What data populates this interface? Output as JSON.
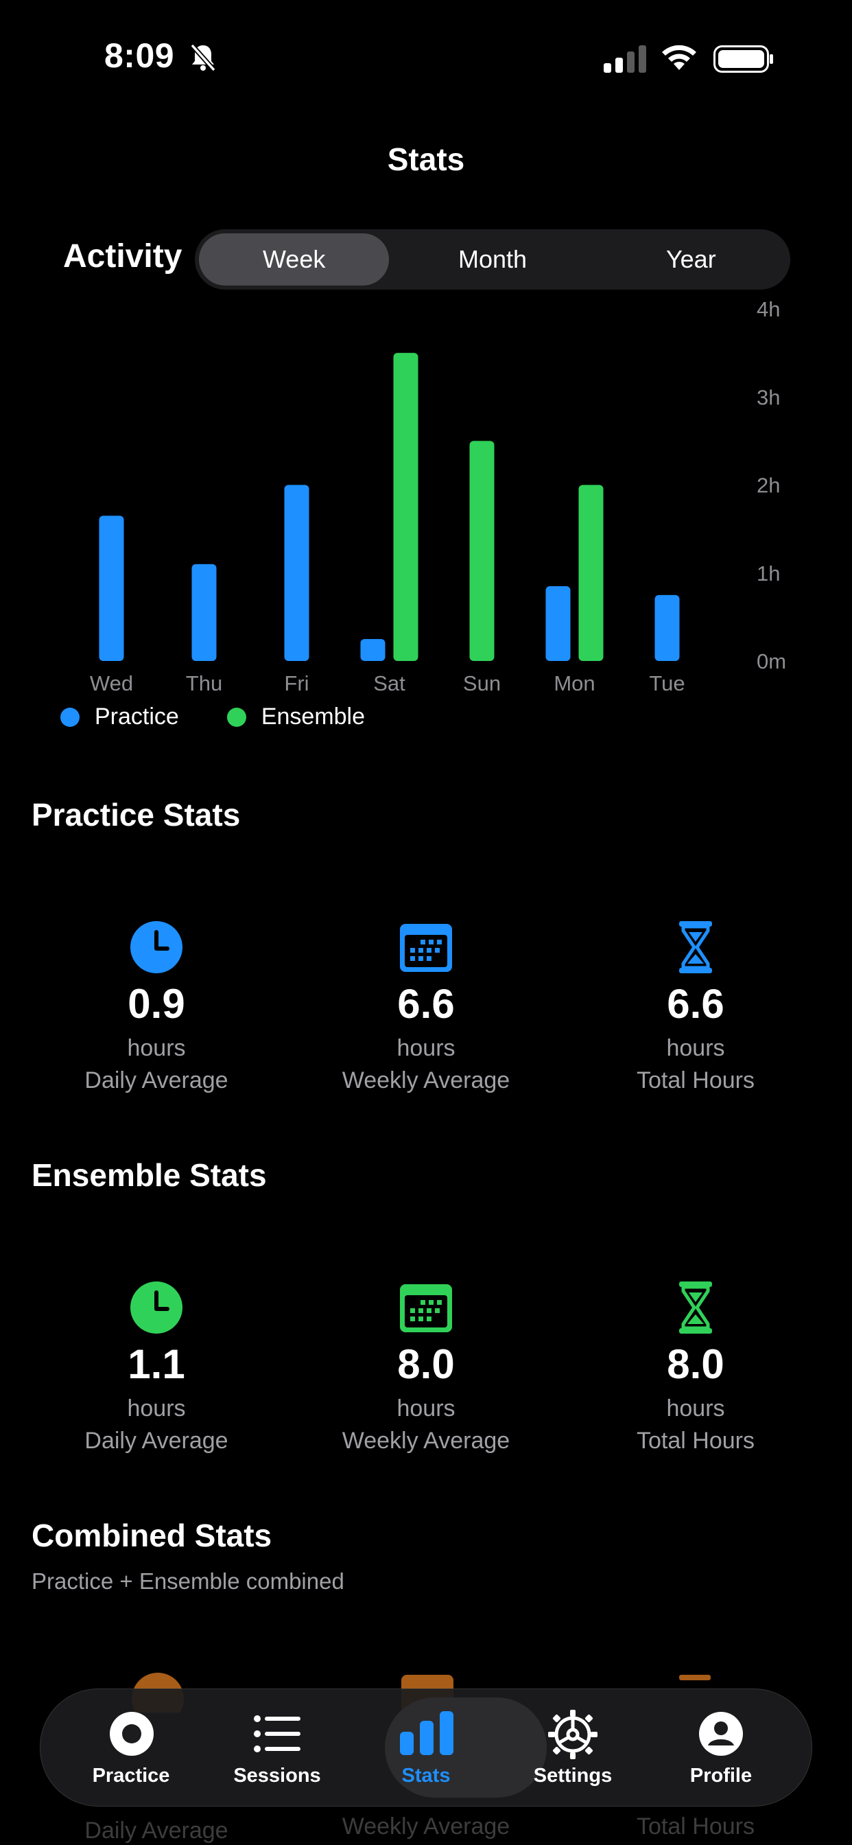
{
  "status_bar": {
    "time": "8:09"
  },
  "nav": {
    "title": "Stats"
  },
  "activity": {
    "label": "Activity",
    "segments": [
      "Week",
      "Month",
      "Year"
    ],
    "selected": "Week"
  },
  "chart_data": {
    "type": "bar",
    "categories": [
      "Wed",
      "Thu",
      "Fri",
      "Sat",
      "Sun",
      "Mon",
      "Tue"
    ],
    "series": [
      {
        "name": "Practice",
        "color": "#1e90ff",
        "values": [
          1.65,
          1.1,
          2.0,
          0.25,
          0,
          0.85,
          0.75
        ]
      },
      {
        "name": "Ensemble",
        "color": "#30d158",
        "values": [
          0,
          0,
          0,
          3.5,
          2.5,
          2.0,
          0
        ]
      }
    ],
    "y_ticks": [
      "0m",
      "1h",
      "2h",
      "3h",
      "4h"
    ],
    "ylim": [
      0,
      4
    ],
    "y_unit": "hours",
    "legend_position": "bottom-left"
  },
  "practice_stats": {
    "title": "Practice Stats",
    "color": "#1e90ff",
    "items": [
      {
        "icon": "clock-icon",
        "value": "0.9",
        "unit": "hours",
        "label": "Daily Average"
      },
      {
        "icon": "calendar-icon",
        "value": "6.6",
        "unit": "hours",
        "label": "Weekly Average"
      },
      {
        "icon": "hourglass-icon",
        "value": "6.6",
        "unit": "hours",
        "label": "Total Hours"
      }
    ]
  },
  "ensemble_stats": {
    "title": "Ensemble Stats",
    "color": "#30d158",
    "items": [
      {
        "icon": "clock-icon",
        "value": "1.1",
        "unit": "hours",
        "label": "Daily Average"
      },
      {
        "icon": "calendar-icon",
        "value": "8.0",
        "unit": "hours",
        "label": "Weekly Average"
      },
      {
        "icon": "hourglass-icon",
        "value": "8.0",
        "unit": "hours",
        "label": "Total Hours"
      }
    ]
  },
  "combined_stats": {
    "title": "Combined Stats",
    "subtitle": "Practice + Ensemble combined",
    "color": "#f08c28",
    "peek_labels": [
      "Daily Average",
      "Weekly Average",
      "Total Hours"
    ]
  },
  "tabbar": {
    "items": [
      {
        "label": "Practice",
        "icon": "record-icon"
      },
      {
        "label": "Sessions",
        "icon": "list-icon"
      },
      {
        "label": "Stats",
        "icon": "bar-chart-icon"
      },
      {
        "label": "Settings",
        "icon": "gear-icon"
      },
      {
        "label": "Profile",
        "icon": "person-icon"
      }
    ],
    "active": "Stats",
    "active_color": "#1e90ff"
  }
}
